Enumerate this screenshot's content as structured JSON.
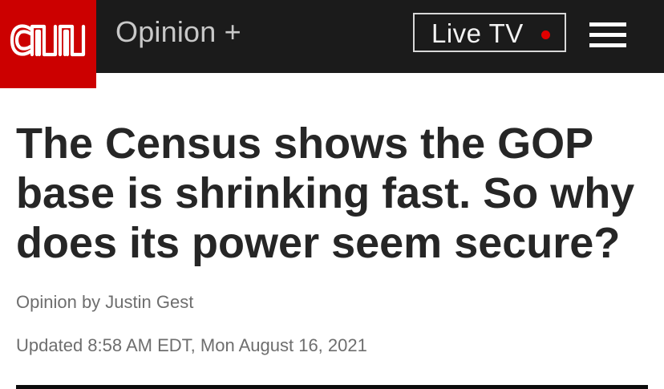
{
  "header": {
    "logo_text": "CNN",
    "section_label": "Opinion +",
    "live_tv_label": "Live TV",
    "menu_icon": "hamburger-menu-icon",
    "live_indicator_icon": "live-dot-icon"
  },
  "article": {
    "headline": "The Census shows the GOP base is shrinking fast. So why does its power seem secure?",
    "byline": "Opinion by Justin Gest",
    "updated": "Updated 8:58 AM EDT, Mon August 16, 2021"
  },
  "colors": {
    "brand_red": "#cc0000",
    "header_bg": "#1b1b1b",
    "live_dot": "#e00000",
    "headline_text": "#262626",
    "meta_text": "#6e6e6e"
  }
}
